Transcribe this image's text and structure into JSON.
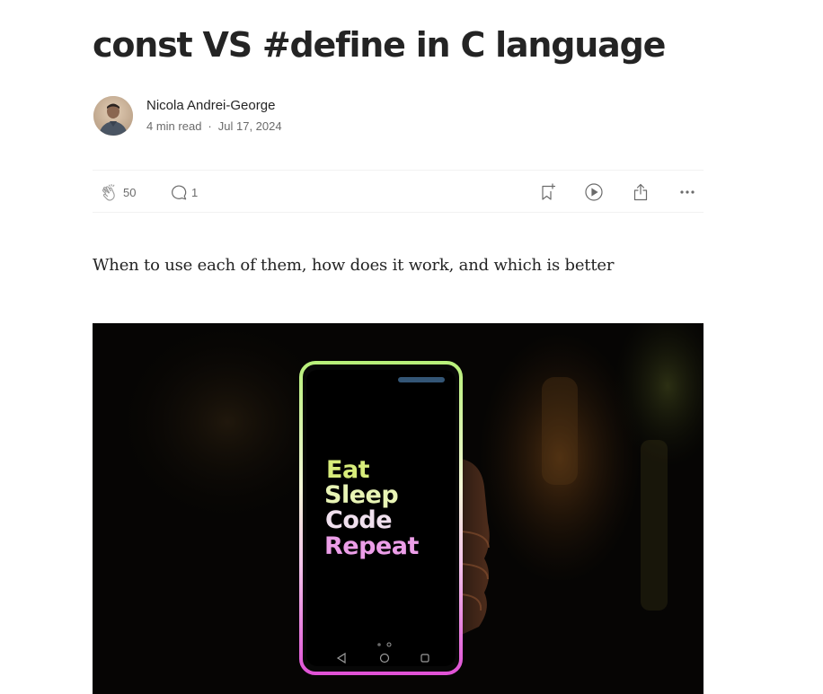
{
  "article": {
    "title": "const VS #define in C language",
    "subtitle": "When to use each of them, how does it work, and which is better"
  },
  "author": {
    "name": "Nicola Andrei-George",
    "read_time": "4 min read",
    "separator": "·",
    "date": "Jul 17, 2024"
  },
  "actions": {
    "claps_count": "50",
    "responses_count": "1",
    "icons": [
      "clap-icon",
      "comment-icon",
      "bookmark-add-icon",
      "play-icon",
      "share-icon",
      "more-icon"
    ]
  },
  "hero_image": {
    "phone_lines": [
      "Eat",
      "Sleep",
      "Code",
      "Repeat"
    ]
  },
  "colors": {
    "text": "#242424",
    "muted": "#6b6b6b",
    "divider": "#f2f2f2",
    "eat": "#d7ec7a",
    "sleep": "#e8f4b5",
    "code": "#f0e0ee",
    "repeat": "#ec9ee8"
  }
}
